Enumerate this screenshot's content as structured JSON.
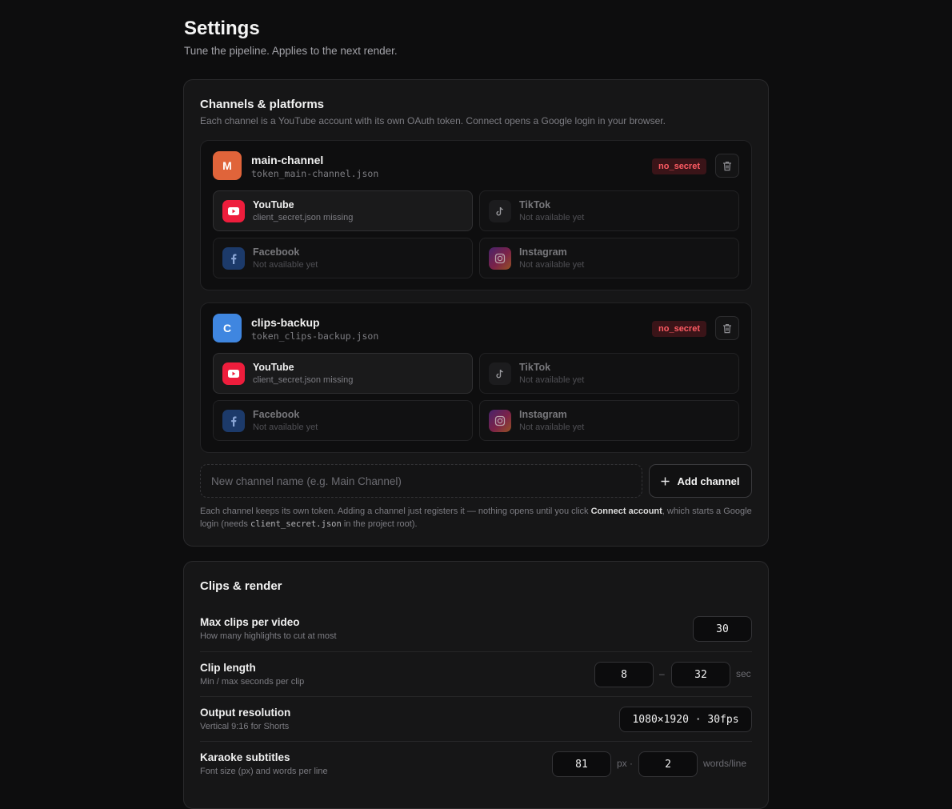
{
  "header": {
    "title": "Settings",
    "subtitle": "Tune the pipeline. Applies to the next render."
  },
  "channels_card": {
    "title": "Channels & platforms",
    "description": "Each channel is a YouTube account with its own OAuth token. Connect opens a Google login in your browser.",
    "channels": [
      {
        "initial": "M",
        "avatar_color": "#e0643a",
        "name": "main-channel",
        "token_file": "token_main-channel.json",
        "badge": "no_secret",
        "platforms": [
          {
            "name": "YouTube",
            "status": "client_secret.json missing",
            "icon": "youtube-icon"
          },
          {
            "name": "TikTok",
            "status": "Not available yet",
            "icon": "tiktok-icon"
          },
          {
            "name": "Facebook",
            "status": "Not available yet",
            "icon": "facebook-icon"
          },
          {
            "name": "Instagram",
            "status": "Not available yet",
            "icon": "instagram-icon"
          }
        ]
      },
      {
        "initial": "C",
        "avatar_color": "#3f86e0",
        "name": "clips-backup",
        "token_file": "token_clips-backup.json",
        "badge": "no_secret",
        "platforms": [
          {
            "name": "YouTube",
            "status": "client_secret.json missing",
            "icon": "youtube-icon"
          },
          {
            "name": "TikTok",
            "status": "Not available yet",
            "icon": "tiktok-icon"
          },
          {
            "name": "Facebook",
            "status": "Not available yet",
            "icon": "facebook-icon"
          },
          {
            "name": "Instagram",
            "status": "Not available yet",
            "icon": "instagram-icon"
          }
        ]
      }
    ],
    "new_channel_placeholder": "New channel name (e.g. Main Channel)",
    "add_button": "Add channel",
    "note": {
      "part1": "Each channel keeps its own token. Adding a channel just registers it — nothing opens until you click ",
      "bold": "Connect account",
      "part2": ", which starts a Google login (needs ",
      "code": "client_secret.json",
      "part3": " in the project root)."
    }
  },
  "render_card": {
    "title": "Clips & render",
    "max_clips": {
      "label": "Max clips per video",
      "help": "How many highlights to cut at most",
      "value": "30"
    },
    "clip_length": {
      "label": "Clip length",
      "help": "Min / max seconds per clip",
      "min": "8",
      "separator": "–",
      "max": "32",
      "unit": "sec"
    },
    "resolution": {
      "label": "Output resolution",
      "help": "Vertical 9:16 for Shorts",
      "value": "1080×1920 · 30fps"
    },
    "subtitles": {
      "label": "Karaoke subtitles",
      "help": "Font size (px) and words per line",
      "font_size": "81",
      "font_unit": "px ·",
      "words": "2",
      "words_unit": "words/line"
    }
  },
  "colors": {
    "background": "#0d0d0e",
    "badge_error": "#ff5b63",
    "youtube_red": "#ee1d3c"
  }
}
